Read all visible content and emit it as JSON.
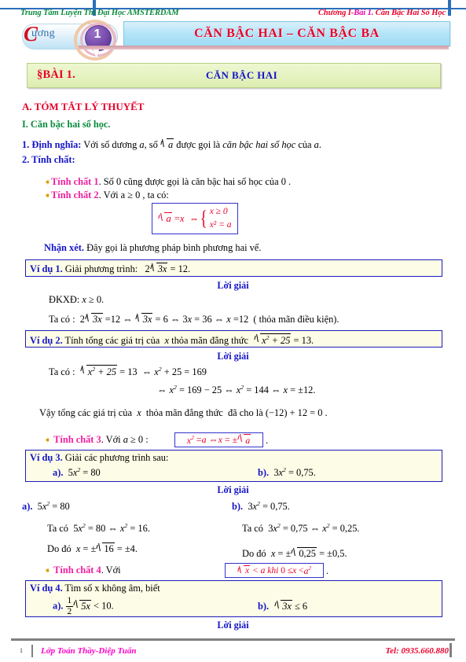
{
  "header": {
    "left": "Trung Tâm Luyện Thi Đại Học AMSTERDAM",
    "right_part1": "Chương I-",
    "right_part2": "Bài 1.",
    "right_part3": " Căn Bậc Hai Số Học"
  },
  "chapter_badge": {
    "word": "ương",
    "initial": "C",
    "number": "1"
  },
  "chapter_title": "CĂN BẬC HAI – CĂN BẬC BA",
  "lesson": {
    "number": "§BÀI 1.",
    "name": "CĂN BẬC HAI"
  },
  "sections": {
    "part_a": "A. TÓM TẮT LÝ THUYẾT",
    "part_i": "I. Căn bậc hai số học."
  },
  "definition": {
    "label": "1. Định nghĩa:",
    "text_1": "Với số dương",
    "var_a": "a",
    "text_2": ", số",
    "sqrt_a": "a",
    "text_3": "được gọi là",
    "emphasis": "căn bậc hai số học",
    "text_4": "của",
    "text_5": "."
  },
  "properties_header": "2. Tính chất:",
  "property1": {
    "label": "Tính chất 1",
    "text": ". Số 0 cũng được gọi là căn bậc hai số học của 0 ."
  },
  "property2": {
    "label": "Tính chất 2",
    "text": ". Với a ≥ 0 , ta có:",
    "formula_left": "a = x",
    "formula_iff": "⇔",
    "formula_line1": "x ≥ 0",
    "formula_line2": "x² = a"
  },
  "remark": {
    "label": "Nhận xét.",
    "text": "Đây gọi là phương pháp bình phương hai vế."
  },
  "example1": {
    "label": "Ví dụ 1.",
    "text": "Giải phương trình:",
    "equation": "2√3x = 12.",
    "solution_header": "Lời giải",
    "line1": "ĐKXĐ: x ≥ 0.",
    "line2": "Ta có : 2√3x = 12 ⇔ √3x = 6 ⇔ 3x = 36 ⇔ x = 12 ( thỏa mãn điều kiện)."
  },
  "example2": {
    "label": "Ví dụ 2.",
    "text": "Tính tổng các giá trị của",
    "var": "x",
    "text2": "thỏa mãn đẳng thức",
    "equation": "√(x² + 25) = 13.",
    "solution_header": "Lời giải",
    "line1": "Ta có : √(x² + 25) = 13 ⇔ x² + 25 = 169",
    "line2": "⇔ x² = 169 − 25 ⇔ x² = 144 ⇔ x = ±12.",
    "line3": "Vậy tổng các giá trị của x thỏa mãn đẳng thức đã cho là (−12) + 12 = 0 ."
  },
  "property3": {
    "label": "Tính chất 3",
    "text": ". Với a ≥ 0 :",
    "formula": "x² = a ⇔ x = ± √a",
    "period": "."
  },
  "example3": {
    "label": "Ví dụ 3.",
    "text": "Giải các phương trình sau:",
    "a_label": "a).",
    "a_eq": "5x² = 80",
    "b_label": "b).",
    "b_eq": "3x² = 0,75.",
    "solution_header": "Lời giải",
    "sol_a_label": "a).",
    "sol_a_eq": "5x² = 80",
    "sol_a_line1": "Ta có  5x² = 80 ⇔ x² = 16.",
    "sol_a_line2": "Do đó  x = ±√16 = ±4.",
    "sol_b_label": "b).",
    "sol_b_eq": "3x² = 0,75.",
    "sol_b_line1": "Ta có  3x² = 0,75 ⇔ x² = 0,25.",
    "sol_b_line2": "Do đó  x = ±√0,25 = ±0,5."
  },
  "property4": {
    "label": "Tính chất 4",
    "text": ". Với",
    "formula": "√x < a khi 0 ≤ x < a²",
    "period": "."
  },
  "example4": {
    "label": "Ví dụ 4.",
    "text": "Tìm số x không âm, biết",
    "a_label": "a).",
    "a_eq": "½√5x < 10.",
    "b_label": "b).",
    "b_eq": "√3x ≤ 6",
    "solution_header": "Lời giải"
  },
  "footer": {
    "page": "1",
    "left": "Lớp Toán Thầy-Diệp Tuấn",
    "right": "Tel: 0935.660.880"
  },
  "colors": {
    "red": "#e8002a",
    "green": "#0a8a3c",
    "blue": "#1414c8",
    "magenta": "#f01fa0",
    "pink": "#ff00c8",
    "box_border": "#1d1dbb",
    "box_bg": "#fdfce6"
  }
}
